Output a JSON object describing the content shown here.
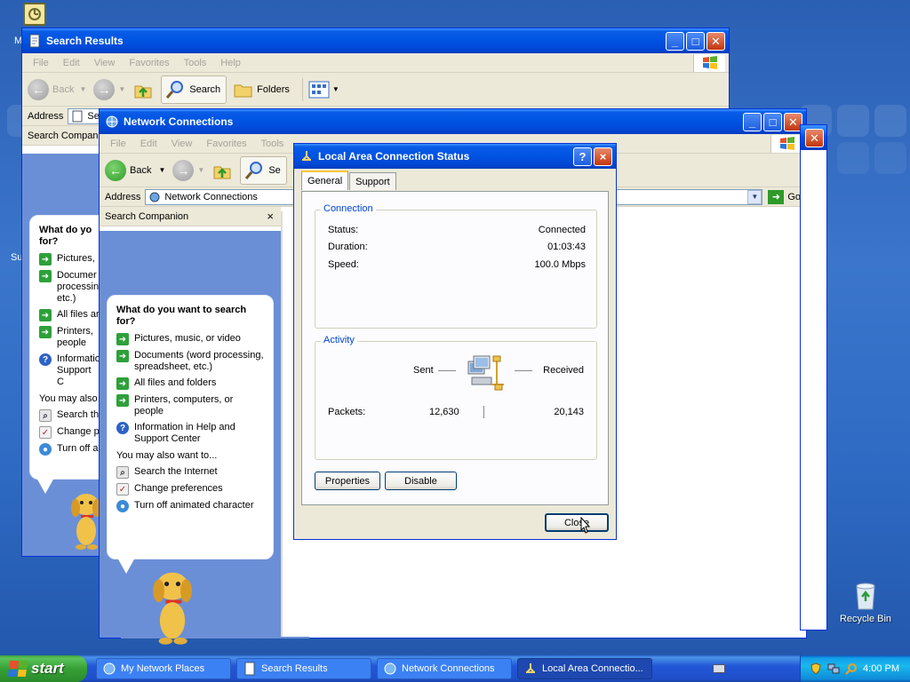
{
  "desktop": {
    "recycle_bin_label": "Recycle Bin"
  },
  "search_results_window": {
    "title": "Search Results",
    "menu": [
      "File",
      "Edit",
      "View",
      "Favorites",
      "Tools",
      "Help"
    ],
    "toolbar": {
      "back": "Back",
      "search": "Search",
      "folders": "Folders"
    },
    "address_label": "Address",
    "address_value": "Se",
    "pane_title": "Search Compani",
    "bubble": {
      "question": "What do yo for?",
      "items": [
        {
          "icon": "arrow",
          "label": "Pictures,"
        },
        {
          "icon": "arrow",
          "label": "Documer processin etc.)"
        },
        {
          "icon": "arrow",
          "label": "All files ar"
        },
        {
          "icon": "arrow",
          "label": "Printers, people"
        },
        {
          "icon": "help",
          "label": "Informatio Support C"
        }
      ],
      "also": "You may also",
      "also_items": [
        {
          "icon": "search",
          "label": "Search th"
        },
        {
          "icon": "prefs",
          "label": "Change p"
        },
        {
          "icon": "globe",
          "label": "Turn off a"
        }
      ]
    }
  },
  "network_window": {
    "title": "Network Connections",
    "menu": [
      "File",
      "Edit",
      "View",
      "Favorites",
      "Tools"
    ],
    "toolbar": {
      "back": "Back",
      "search": "Se"
    },
    "address_label": "Address",
    "address_value": "Network Connections",
    "go_label": "Go",
    "pane_title": "Search Companion",
    "pane_close": "×",
    "bubble": {
      "question": "What do you want to search for?",
      "items": [
        {
          "icon": "arrow",
          "label": "Pictures, music, or video"
        },
        {
          "icon": "arrow",
          "label": "Documents (word processing, spreadsheet, etc.)"
        },
        {
          "icon": "arrow",
          "label": "All files and folders"
        },
        {
          "icon": "arrow",
          "label": "Printers, computers, or people"
        },
        {
          "icon": "help",
          "label": "Information in Help and Support Center"
        }
      ],
      "also": "You may also want to...",
      "also_items": [
        {
          "icon": "search",
          "label": "Search the Internet"
        },
        {
          "icon": "prefs",
          "label": "Change preferences"
        },
        {
          "icon": "globe",
          "label": "Turn off animated character"
        }
      ]
    }
  },
  "status_dialog": {
    "title": "Local Area Connection Status",
    "help": "?",
    "close_x": "×",
    "tabs": [
      "General",
      "Support"
    ],
    "connection": {
      "legend": "Connection",
      "status_label": "Status:",
      "status_value": "Connected",
      "duration_label": "Duration:",
      "duration_value": "01:03:43",
      "speed_label": "Speed:",
      "speed_value": "100.0 Mbps"
    },
    "activity": {
      "legend": "Activity",
      "sent_label": "Sent",
      "received_label": "Received",
      "packets_label": "Packets:",
      "packets_sent": "12,630",
      "packets_received": "20,143"
    },
    "buttons": {
      "properties": "Properties",
      "disable": "Disable",
      "close": "Close"
    }
  },
  "taskbar": {
    "start_label": "start",
    "tasks": [
      {
        "label": "My Network Places",
        "active": false
      },
      {
        "label": "Search Results",
        "active": false
      },
      {
        "label": "Network Connections",
        "active": false
      },
      {
        "label": "Local Area Connectio...",
        "active": true
      }
    ],
    "clock": "4:00 PM"
  },
  "colors": {
    "titlebar_blue": "#0054e3",
    "companion_blue": "#6b8fd6",
    "dialog_face": "#ece9d8",
    "group_legend": "#0046d5",
    "taskbar_blue": "#2157d7",
    "start_green": "#36a136"
  }
}
